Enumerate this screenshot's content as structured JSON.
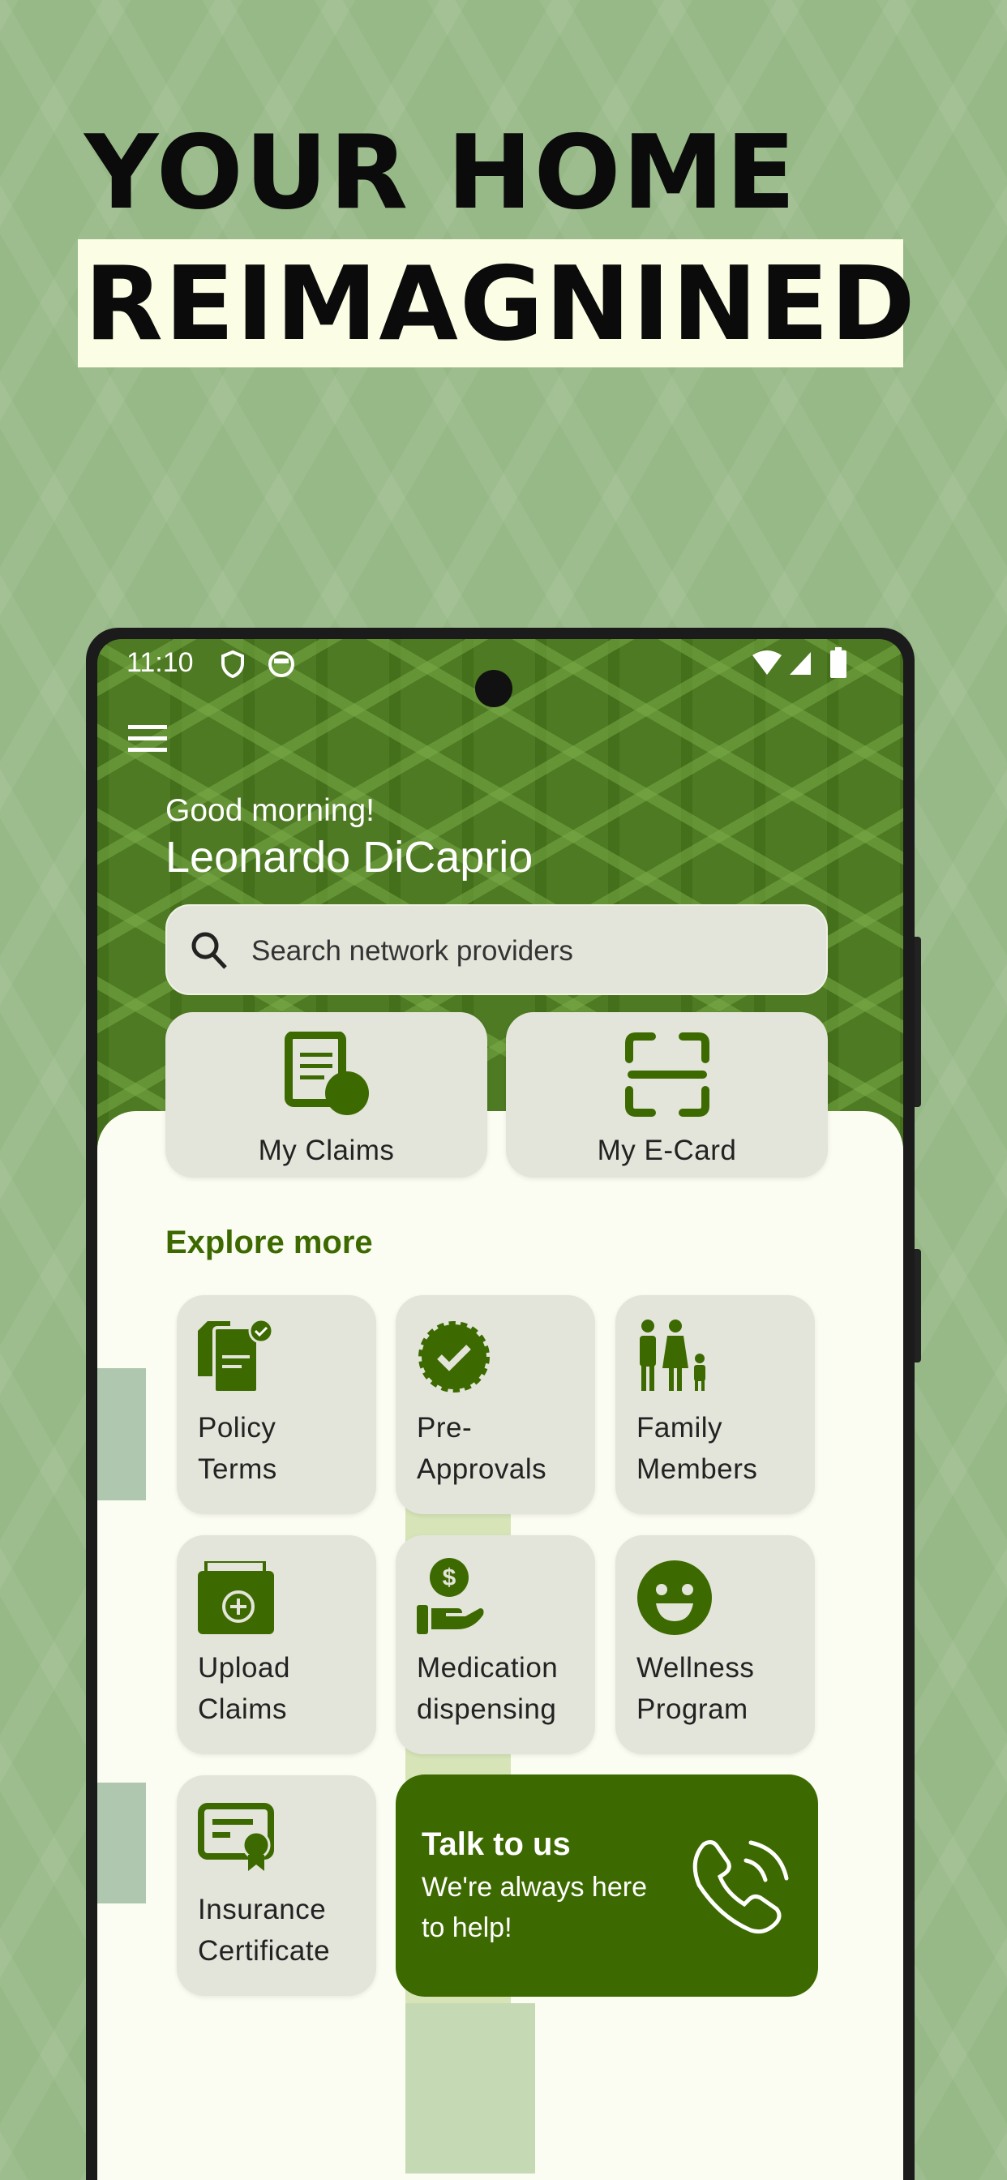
{
  "headline": {
    "line1": "YOUR HOME",
    "line2": "REIMAGNINED"
  },
  "status_bar": {
    "time": "11:10",
    "icons": [
      "shield-icon",
      "face-icon",
      "wifi-icon",
      "signal-icon",
      "battery-icon"
    ]
  },
  "header": {
    "menu_icon": "hamburger-icon",
    "greeting": "Good morning!",
    "user_name": "Leonardo DiCaprio"
  },
  "search": {
    "placeholder": "Search network providers",
    "icon": "search-icon"
  },
  "quick_actions": [
    {
      "label": "My Claims",
      "icon": "claims-document-icon"
    },
    {
      "label": "My E-Card",
      "icon": "scan-card-icon"
    }
  ],
  "explore": {
    "title": "Explore more",
    "items": [
      {
        "line1": "Policy",
        "line2": "Terms",
        "icon": "policy-document-icon"
      },
      {
        "line1": "Pre-",
        "line2": "Approvals",
        "icon": "verified-badge-icon"
      },
      {
        "line1": "Family",
        "line2": "Members",
        "icon": "family-icon"
      },
      {
        "line1": "Upload",
        "line2": "Claims",
        "icon": "folder-add-icon"
      },
      {
        "line1": "Medication",
        "line2": "dispensing",
        "icon": "hand-dollar-icon"
      },
      {
        "line1": "Wellness",
        "line2": "Program",
        "icon": "smiley-icon"
      },
      {
        "line1": "Insurance",
        "line2": "Certificate",
        "icon": "certificate-icon"
      }
    ]
  },
  "talk": {
    "title": "Talk to us",
    "line1": "We're always here",
    "line2": "to help!",
    "icon": "phone-call-icon"
  },
  "colors": {
    "accent": "#3d6a00",
    "page_bg": "#97b987",
    "card_bg": "#e3e5da",
    "sheet_bg": "#fbfcf2",
    "highlight": "#fbfde4"
  }
}
